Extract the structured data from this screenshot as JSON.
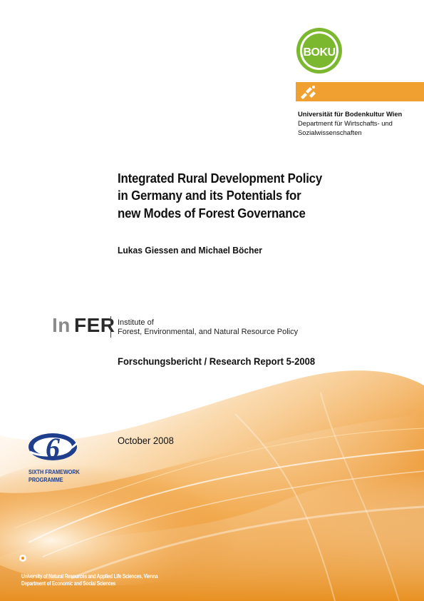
{
  "logo": {
    "text": "BOKU",
    "colors": {
      "ring": "#7cb82f",
      "bar": "#f0a030"
    }
  },
  "university": {
    "name": "Universität für Bodenkultur Wien",
    "department_lines": [
      "Department für Wirtschafts- und",
      "Sozialwissenschaften"
    ]
  },
  "title_lines": [
    "Integrated Rural Development Policy",
    "in Germany and its Potentials for",
    "new Modes of Forest Governance"
  ],
  "authors": "Lukas Giessen and Michael Böcher",
  "infer": {
    "logo_prefix": "In",
    "logo_suffix": "FER",
    "lines": [
      "Institute of",
      "Forest, Environmental, and Natural Resource Policy"
    ]
  },
  "report": "Forschungsbericht / Research Report 5-2008",
  "date": "October 2008",
  "fp6": {
    "number": "6",
    "lines": [
      "SIXTH FRAMEWORK",
      "PROGRAMME"
    ],
    "color": "#1f3f8c"
  },
  "footer": {
    "lines": [
      "University of Natural Resources and Applied Life Sciences, Vienna",
      "Department of Economic and Social Sciences"
    ]
  },
  "theme": {
    "accent": "#f0a030",
    "text": "#111111"
  }
}
